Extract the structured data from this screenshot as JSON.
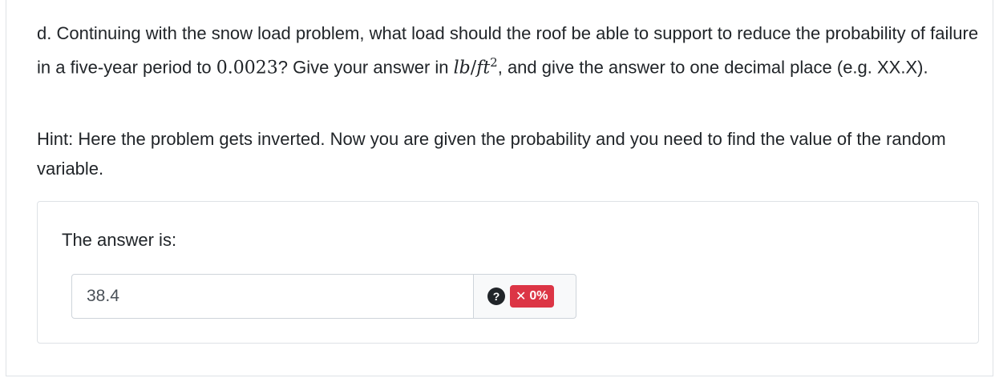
{
  "question": {
    "intro": "d. Continuing with the snow load problem, what load should the roof be able to support to reduce the probability of failure in a five-year period to ",
    "prob_value": "0.0023",
    "middle": "? Give your answer in ",
    "unit_lb": "lb",
    "unit_slash": "/",
    "unit_ft": "ft",
    "unit_exp": "2",
    "end": ", and give the answer to one decimal place (e.g. XX.X)."
  },
  "hint": "Hint: Here the problem gets inverted. Now you are given the probability and you need to find the value of the random variable.",
  "answer": {
    "label": "The answer is:",
    "value": "38.4",
    "help_icon": "?",
    "score_mark": "✕",
    "score_text": "0%",
    "score_color": "#dc3545"
  }
}
